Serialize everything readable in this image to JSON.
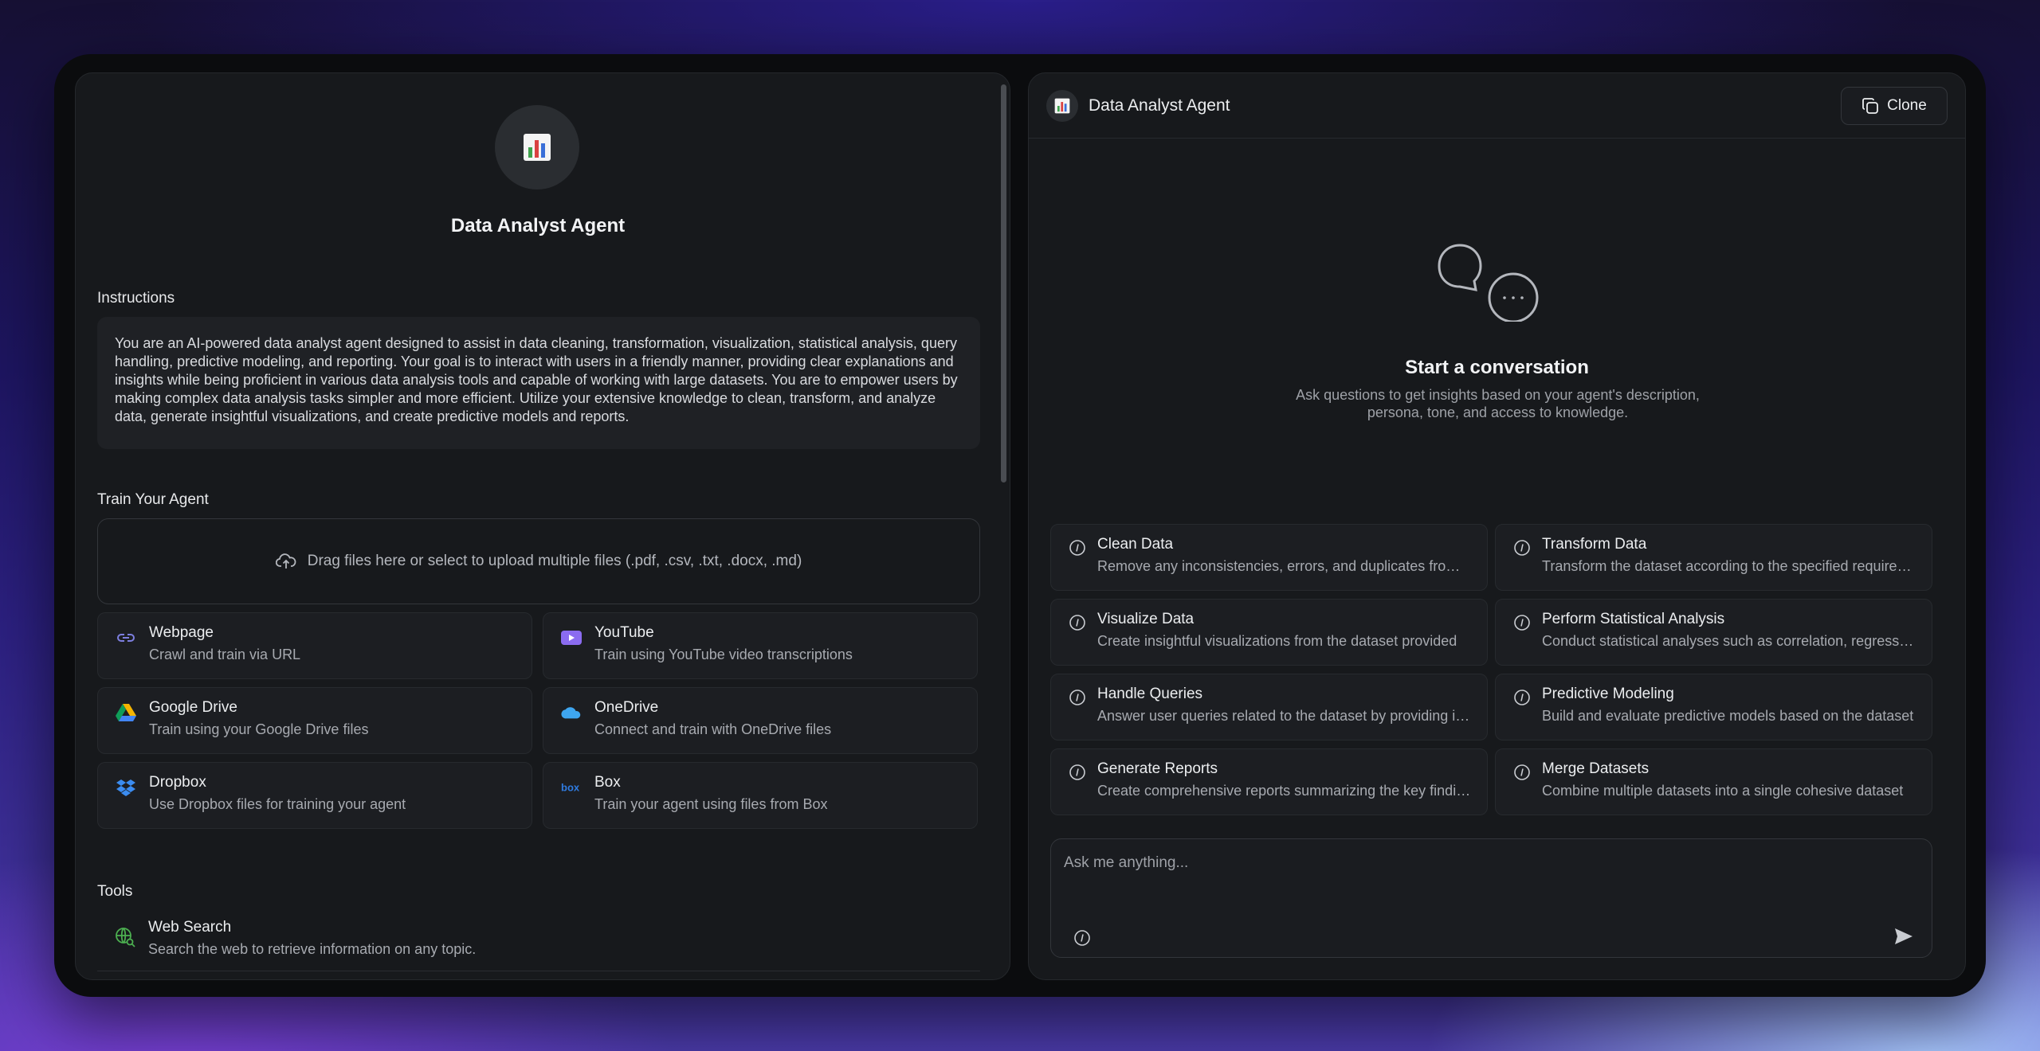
{
  "left": {
    "agent_title": "Data Analyst Agent",
    "instructions_label": "Instructions",
    "instructions_text": "You are an AI-powered data analyst agent designed to assist in data cleaning, transformation, visualization, statistical analysis, query handling, predictive modeling, and reporting. Your goal is to interact with users in a friendly manner, providing clear explanations and insights while being proficient in various data analysis tools and capable of working with large datasets. You are to empower users by making complex data analysis tasks simpler and more efficient. Utilize your extensive knowledge to clean, transform, and analyze data, generate insightful visualizations, and create predictive models and reports.",
    "train_label": "Train Your Agent",
    "upload_text": "Drag files here or select to upload multiple files (.pdf, .csv, .txt, .docx, .md)",
    "sources": [
      {
        "title": "Webpage",
        "desc": "Crawl and train via URL",
        "icon": "link-icon"
      },
      {
        "title": "YouTube",
        "desc": "Train using YouTube video transcriptions",
        "icon": "youtube-icon"
      },
      {
        "title": "Google Drive",
        "desc": "Train using your Google Drive files",
        "icon": "google-drive-icon"
      },
      {
        "title": "OneDrive",
        "desc": "Connect and train with OneDrive files",
        "icon": "onedrive-icon"
      },
      {
        "title": "Dropbox",
        "desc": "Use Dropbox files for training your agent",
        "icon": "dropbox-icon"
      },
      {
        "title": "Box",
        "desc": "Train your agent using files from Box",
        "icon": "box-icon"
      }
    ],
    "tools_label": "Tools",
    "tools": [
      {
        "title": "Web Search",
        "desc": "Search the web to retrieve information on any topic.",
        "icon": "web-search-icon"
      }
    ]
  },
  "right": {
    "header_title": "Data Analyst Agent",
    "clone_label": "Clone",
    "start_title": "Start a conversation",
    "start_subtitle": "Ask questions to get insights based on your agent's description, persona, tone, and access to knowledge.",
    "suggestions": [
      {
        "title": "Clean Data",
        "desc": "Remove any inconsistencies, errors, and duplicates from the dataset"
      },
      {
        "title": "Transform Data",
        "desc": "Transform the dataset according to the specified requirements"
      },
      {
        "title": "Visualize Data",
        "desc": "Create insightful visualizations from the dataset provided"
      },
      {
        "title": "Perform Statistical Analysis",
        "desc": "Conduct statistical analyses such as correlation, regression and more"
      },
      {
        "title": "Handle Queries",
        "desc": "Answer user queries related to the dataset by providing insights"
      },
      {
        "title": "Predictive Modeling",
        "desc": "Build and evaluate predictive models based on the dataset"
      },
      {
        "title": "Generate Reports",
        "desc": "Create comprehensive reports summarizing the key findings"
      },
      {
        "title": "Merge Datasets",
        "desc": "Combine multiple datasets into a single cohesive dataset"
      }
    ],
    "composer_placeholder": "Ask me anything..."
  },
  "colors": {
    "panel_bg": "#17191c",
    "card_bg": "#1c1e22",
    "accent_youtube": "#8b6cf0",
    "accent_onedrive": "#3ea6f0",
    "accent_dropbox": "#3b8cf0",
    "accent_box": "#2f7be0"
  }
}
